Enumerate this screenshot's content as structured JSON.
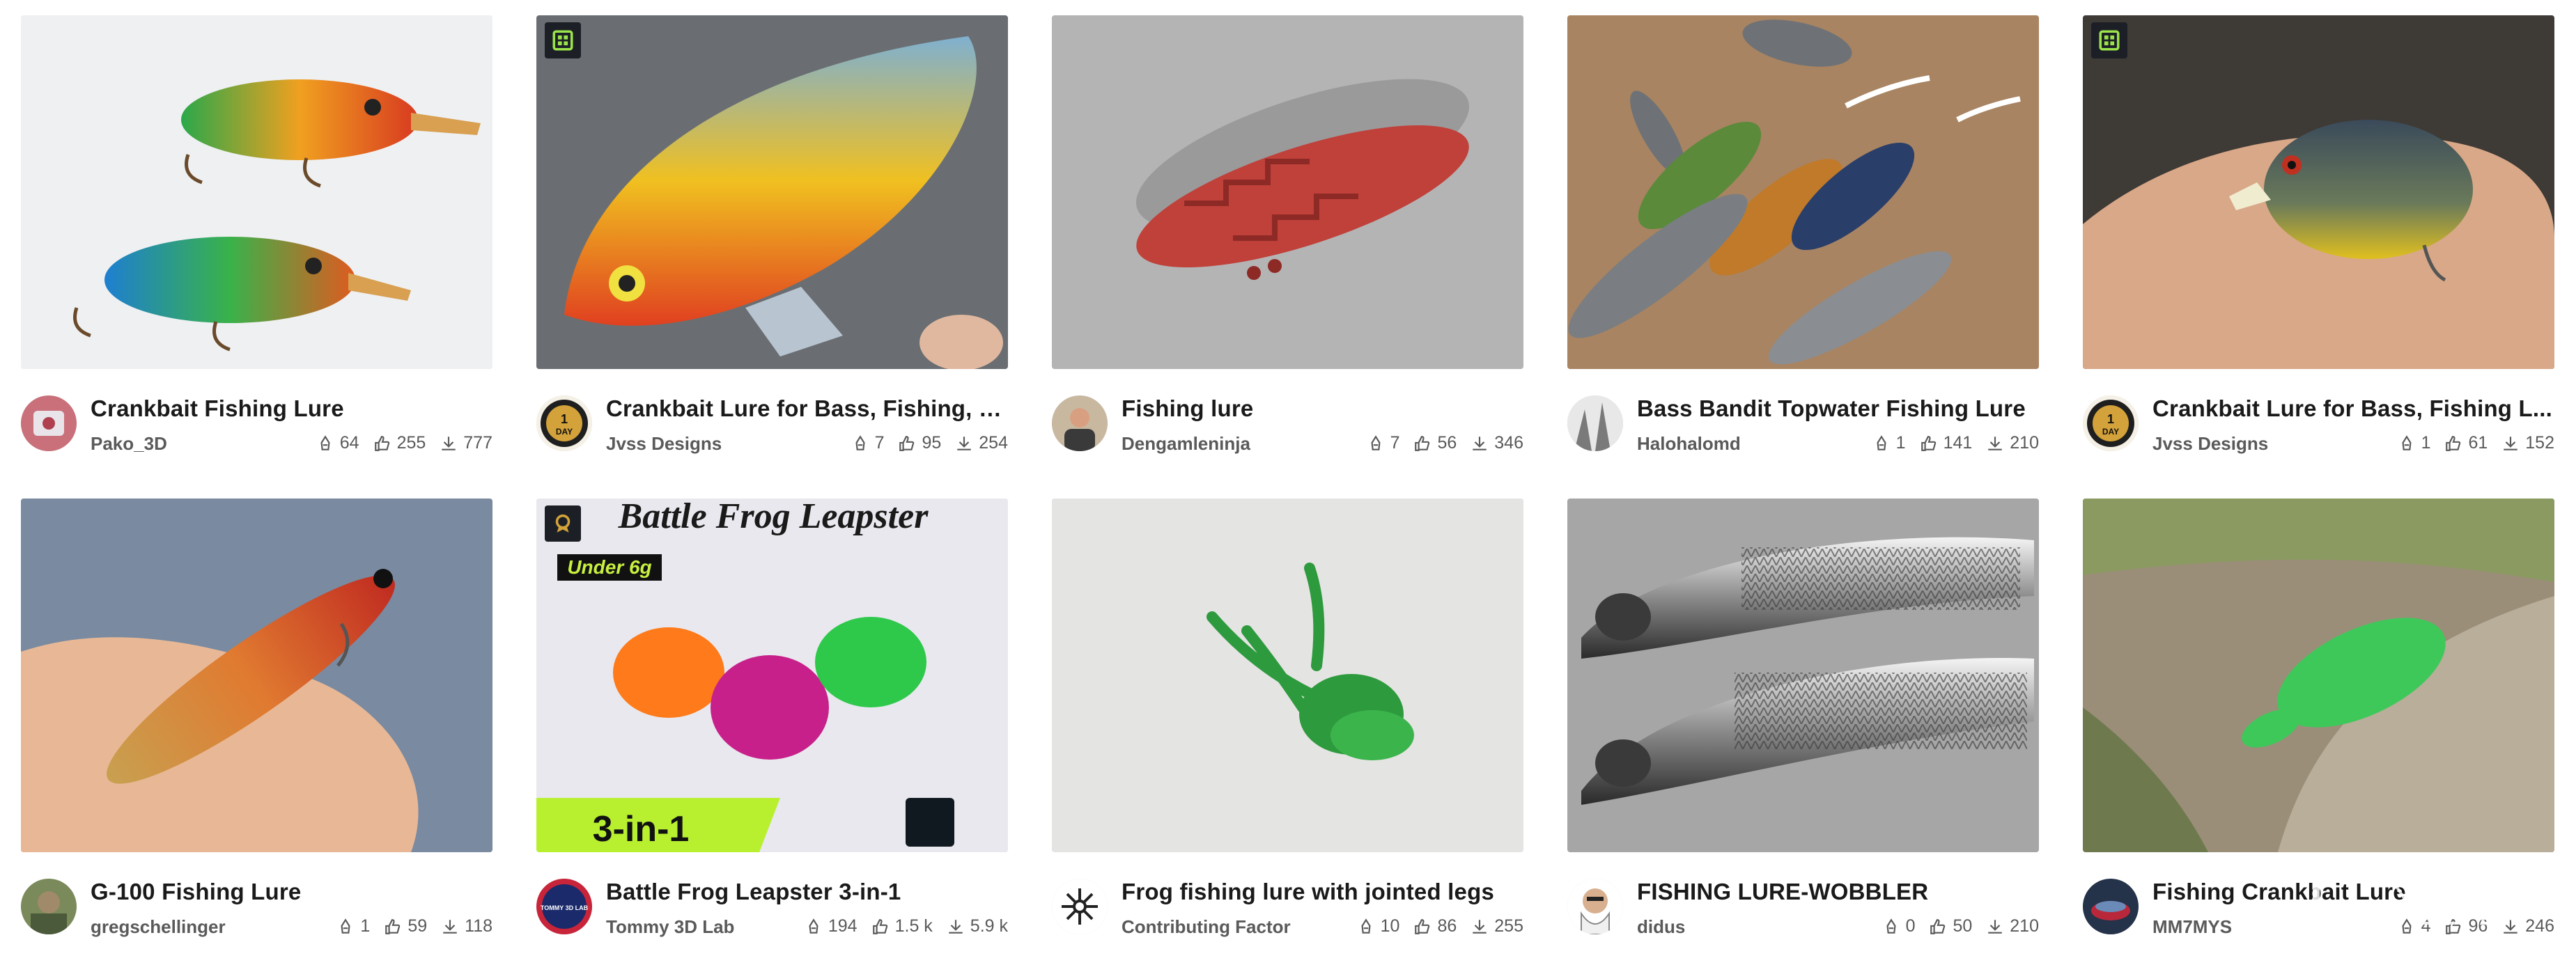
{
  "items": [
    {
      "title": "Crankbait Fishing Lure",
      "author": "Pako_3D",
      "makes": "64",
      "likes": "255",
      "downloads": "777",
      "badge": false
    },
    {
      "title": "Crankbait Lure for Bass, Fishing, T...",
      "author": "Jvss Designs",
      "makes": "7",
      "likes": "95",
      "downloads": "254",
      "badge": true
    },
    {
      "title": "Fishing lure",
      "author": "Dengamleninja",
      "makes": "7",
      "likes": "56",
      "downloads": "346",
      "badge": false
    },
    {
      "title": "Bass Bandit Topwater Fishing Lure",
      "author": "Halohalomd",
      "makes": "1",
      "likes": "141",
      "downloads": "210",
      "badge": false
    },
    {
      "title": "Crankbait Lure for Bass, Fishing L...",
      "author": "Jvss Designs",
      "makes": "1",
      "likes": "61",
      "downloads": "152",
      "badge": true
    },
    {
      "title": "G-100 Fishing Lure",
      "author": "gregschellinger",
      "makes": "1",
      "likes": "59",
      "downloads": "118",
      "badge": false
    },
    {
      "title": "Battle Frog Leapster 3-in-1",
      "author": "Tommy 3D Lab",
      "makes": "194",
      "likes": "1.5 k",
      "downloads": "5.9 k",
      "badge": true,
      "image_text": {
        "heading": "Battle Frog Leapster",
        "sub": "Under 6g",
        "tag": "3-in-1"
      }
    },
    {
      "title": "Frog fishing lure with jointed legs",
      "author": "Contributing Factor",
      "makes": "10",
      "likes": "86",
      "downloads": "255",
      "badge": false
    },
    {
      "title": "FISHING LURE-WOBBLER",
      "author": "didus",
      "makes": "0",
      "likes": "50",
      "downloads": "210",
      "badge": false
    },
    {
      "title": "Fishing Crankbait Lure",
      "author": "MM7MYS",
      "makes": "4",
      "likes": "96",
      "downloads": "246",
      "badge": false
    }
  ],
  "avatar_badge_text": {
    "top": "1",
    "bottom": "DAY"
  },
  "avatar_tommy_text": "TOMMY 3D LAB",
  "watermark_text": "XDA",
  "colors": {
    "title": "#1a1a1a",
    "muted": "#5a5a5a",
    "badge_bg": "#1c2026",
    "badge_fg": "#9be34a"
  },
  "icons": {
    "makes": "makes-icon",
    "likes": "thumbs-up-icon",
    "downloads": "download-icon",
    "badge": "grid-badge-icon"
  }
}
